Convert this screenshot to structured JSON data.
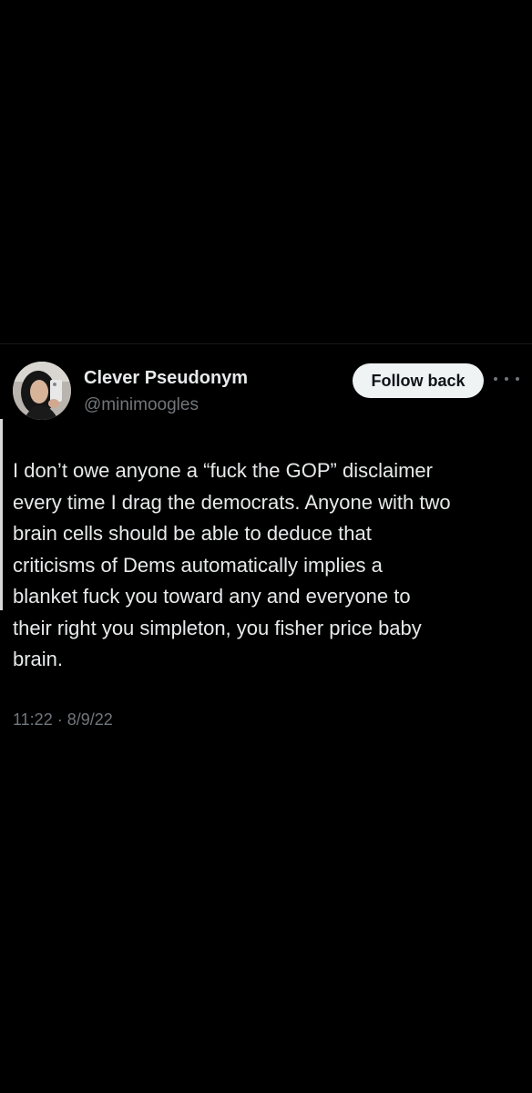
{
  "tweet": {
    "author": {
      "display_name": "Clever Pseudonym",
      "handle": "@minimoogles",
      "avatar_icon": "profile-photo"
    },
    "follow_button_label": "Follow back",
    "more_icon": "more-horizontal-icon",
    "text_lines": [
      "I don’t owe anyone a “fuck the GOP” disclaimer",
      "every time I drag the democrats. Anyone with two",
      "brain cells should be able to deduce that",
      "criticisms of Dems automatically implies a",
      "blanket fuck you toward any and everyone to",
      "their right you simpleton, you fisher price baby",
      "brain."
    ],
    "timestamp": "11:22 · 8/9/22"
  },
  "colors": {
    "background": "#000000",
    "primary_text": "#e7e9ea",
    "secondary_text": "#71767b",
    "button_bg": "#eff3f4",
    "button_text": "#0f1419"
  }
}
